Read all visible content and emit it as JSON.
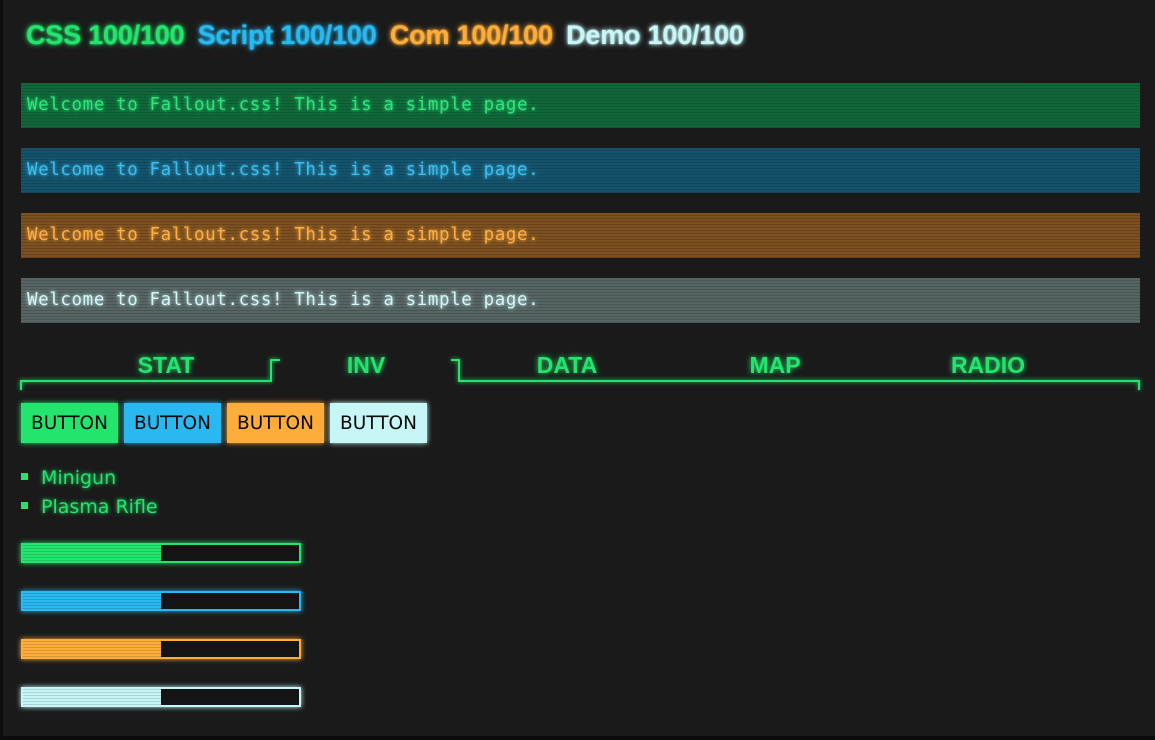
{
  "header": {
    "stats": [
      {
        "label": "CSS 100/100",
        "color": "#23e56d"
      },
      {
        "label": "Script 100/100",
        "color": "#29b9f0"
      },
      {
        "label": "Com 100/100",
        "color": "#ffad3a"
      },
      {
        "label": "Demo 100/100",
        "color": "#c7f6f6"
      }
    ]
  },
  "welcome_bars": [
    {
      "text": "Welcome to Fallout.css! This is a simple page.",
      "fg": "#2fe57a",
      "bg": "#10683a"
    },
    {
      "text": "Welcome to Fallout.css! This is a simple page.",
      "fg": "#3bbff0",
      "bg": "#15536c"
    },
    {
      "text": "Welcome to Fallout.css! This is a simple page.",
      "fg": "#ffae42",
      "bg": "#7c5020"
    },
    {
      "text": "Welcome to Fallout.css! This is a simple page.",
      "fg": "#d2f6f6",
      "bg": "#566564"
    }
  ],
  "tabs": {
    "color": "#23e56d",
    "active": "INV",
    "items": [
      "STAT",
      "INV",
      "DATA",
      "MAP",
      "RADIO"
    ]
  },
  "buttons": [
    {
      "label": "BUTTON",
      "color": "#23e56d"
    },
    {
      "label": "BUTTON",
      "color": "#29b9f0"
    },
    {
      "label": "BUTTON",
      "color": "#ffad3a"
    },
    {
      "label": "BUTTON",
      "color": "#c7f6f6"
    }
  ],
  "inventory": {
    "color": "#23e56d",
    "items": [
      "Minigun",
      "Plasma Rifle"
    ]
  },
  "progress_bars": [
    {
      "value": 50,
      "color": "#23e56d"
    },
    {
      "value": 50,
      "color": "#29b9f0"
    },
    {
      "value": 50,
      "color": "#ffad3a"
    },
    {
      "value": 50,
      "color": "#c7f6f6"
    }
  ]
}
